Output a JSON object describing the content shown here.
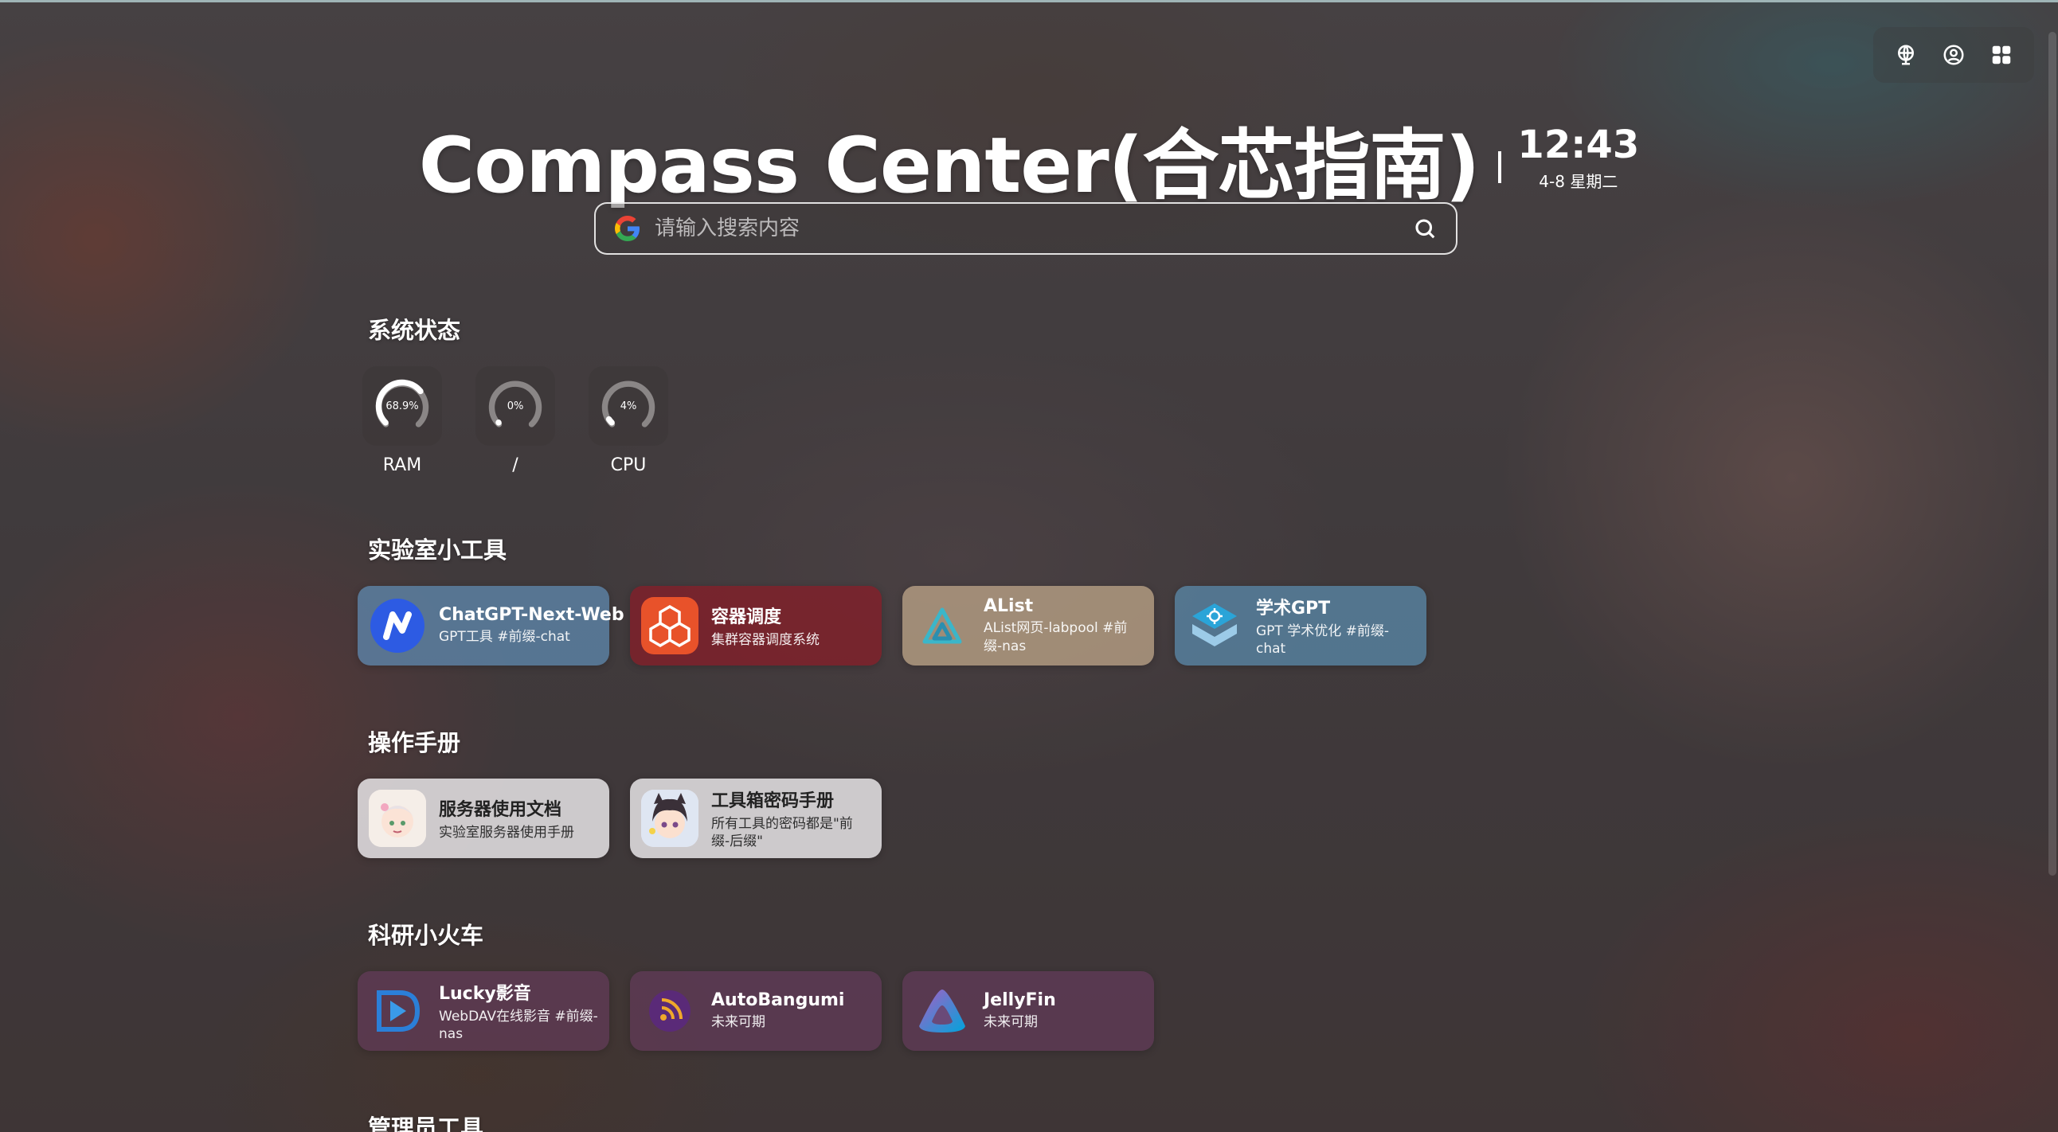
{
  "header": {
    "title": "Compass Center(合芯指南)",
    "time": "12:43",
    "date": "4-8 星期二"
  },
  "topbar": {
    "icons": [
      "globe-icon",
      "user-sync-icon",
      "grid-icon"
    ]
  },
  "search": {
    "placeholder": "请输入搜索内容",
    "engine_icon": "google-icon"
  },
  "system_status": {
    "title": "系统状态",
    "gauges": [
      {
        "label": "RAM",
        "value_text": "68.9%",
        "value": 68.9
      },
      {
        "label": "/",
        "value_text": "0%",
        "value": 0
      },
      {
        "label": "CPU",
        "value_text": "4%",
        "value": 4
      }
    ]
  },
  "sections": [
    {
      "title": "实验室小工具",
      "cards": [
        {
          "title": "ChatGPT-Next-Web",
          "desc": "GPT工具 #前缀-chat",
          "icon": "nextchat-icon"
        },
        {
          "title": "容器调度",
          "desc": "集群容器调度系统",
          "icon": "container-icon"
        },
        {
          "title": "AList",
          "desc": "AList网页-labpool #前缀-nas",
          "icon": "alist-icon"
        },
        {
          "title": "学术GPT",
          "desc": "GPT 学术优化 #前缀-chat",
          "icon": "academic-gpt-icon"
        }
      ]
    },
    {
      "title": "操作手册",
      "cards": [
        {
          "title": "服务器使用文档",
          "desc": "实验室服务器使用手册",
          "icon": "anime-avatar-icon"
        },
        {
          "title": "工具箱密码手册",
          "desc": "所有工具的密码都是\"前缀-后缀\"",
          "icon": "anime-avatar-icon"
        }
      ]
    },
    {
      "title": "科研小火车",
      "cards": [
        {
          "title": "Lucky影音",
          "desc": "WebDAV在线影音 #前缀-nas",
          "icon": "play-icon"
        },
        {
          "title": "AutoBangumi",
          "desc": "未来可期",
          "icon": "rss-icon"
        },
        {
          "title": "JellyFin",
          "desc": "未来可期",
          "icon": "jellyfin-icon"
        }
      ]
    },
    {
      "title": "管理员工具",
      "cards": []
    }
  ],
  "colors": {
    "accent_white": "#ffffff",
    "card_blue": "#5f8cb4",
    "card_red": "#871e28",
    "card_beige": "#c3aa8c",
    "card_light": "#e1dee0",
    "card_purple": "#6e3c64"
  }
}
